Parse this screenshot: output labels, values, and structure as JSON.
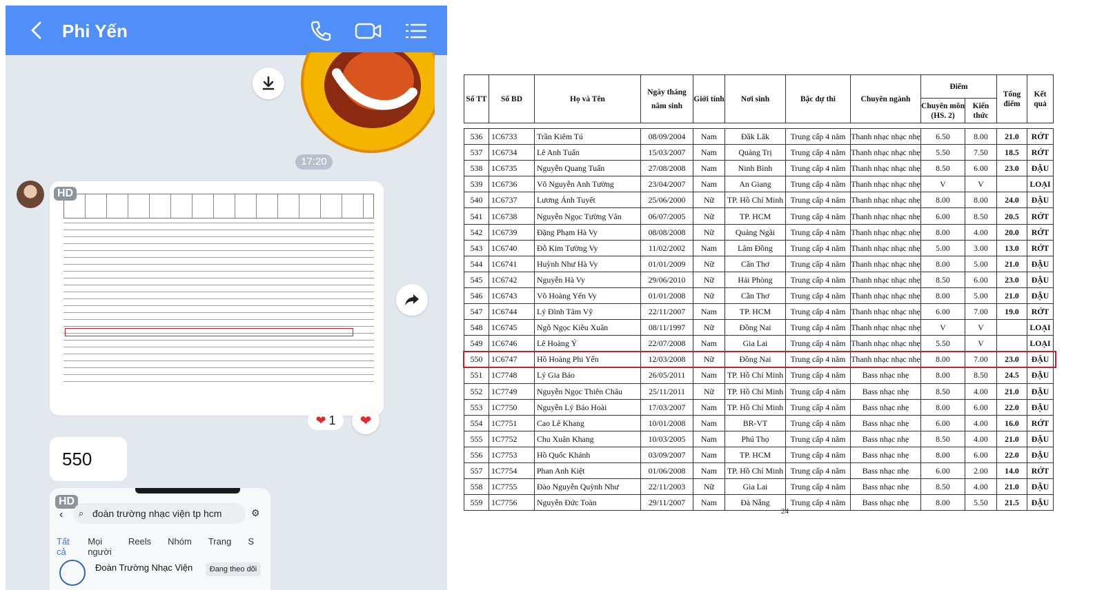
{
  "chat": {
    "contact_name": "Phi Yến",
    "time": "17:20",
    "hd_label": "HD",
    "reaction_count": "1",
    "text_message": "550",
    "icons": [
      "back-icon",
      "phone-icon",
      "video-icon",
      "menu-list-icon",
      "download-icon",
      "share-icon",
      "heart-icon"
    ],
    "shared_screenshot": {
      "search_text": "đoàn trường nhạc viện tp hcm",
      "tabs": [
        "Tất cả",
        "Mọi người",
        "Reels",
        "Nhóm",
        "Trang",
        "S"
      ],
      "result_name": "Đoàn Trường Nhạc Viện",
      "follow_label": "Đang theo dõi"
    }
  },
  "document": {
    "headers": {
      "stt": "Số TT",
      "sbd": "Số BD",
      "name": "Họ và Tên",
      "dob": "Ngày tháng năm sinh",
      "gender": "Giới tính",
      "place": "Nơi sinh",
      "level": "Bậc dự thi",
      "major": "Chuyên ngành",
      "diem": "Điểm",
      "chuyen_mon": "Chuyên môn (HS. 2)",
      "kien_thuc": "Kiến thức",
      "total": "Tổng điểm",
      "result": "Kết quả"
    },
    "page_number": "24",
    "rows": [
      {
        "stt": "536",
        "sbd": "1C6733",
        "name": "Trần Kiêm Tú",
        "dob": "08/09/2004",
        "gender": "Nam",
        "place": "Đăk Lăk",
        "level": "Trung cấp 4 năm",
        "major": "Thanh nhạc nhạc nhẹ",
        "cm": "6.50",
        "kt": "8.00",
        "total": "21.0",
        "result": "RỚT"
      },
      {
        "stt": "537",
        "sbd": "1C6734",
        "name": "Lê Anh Tuấn",
        "dob": "15/03/2007",
        "gender": "Nam",
        "place": "Quảng Trị",
        "level": "Trung cấp 4 năm",
        "major": "Thanh nhạc nhạc nhẹ",
        "cm": "5.50",
        "kt": "7.50",
        "total": "18.5",
        "result": "RỚT"
      },
      {
        "stt": "538",
        "sbd": "1C6735",
        "name": "Nguyễn Quang Tuấn",
        "dob": "27/08/2008",
        "gender": "Nam",
        "place": "Ninh Bình",
        "level": "Trung cấp 4 năm",
        "major": "Thanh nhạc nhạc nhẹ",
        "cm": "8.50",
        "kt": "6.00",
        "total": "23.0",
        "result": "ĐẬU"
      },
      {
        "stt": "539",
        "sbd": "1C6736",
        "name": "Võ Nguyễn Anh Tường",
        "dob": "23/04/2007",
        "gender": "Nam",
        "place": "An Giang",
        "level": "Trung cấp 4 năm",
        "major": "Thanh nhạc nhạc nhẹ",
        "cm": "V",
        "kt": "V",
        "total": "",
        "result": "LOẠI"
      },
      {
        "stt": "540",
        "sbd": "1C6737",
        "name": "Lương Ánh Tuyết",
        "dob": "25/06/2000",
        "gender": "Nữ",
        "place": "TP. Hồ Chí Minh",
        "level": "Trung cấp 4 năm",
        "major": "Thanh nhạc nhạc nhẹ",
        "cm": "8.00",
        "kt": "8.00",
        "total": "24.0",
        "result": "ĐẬU"
      },
      {
        "stt": "541",
        "sbd": "1C6738",
        "name": "Nguyễn Ngọc Tường Vân",
        "dob": "06/07/2005",
        "gender": "Nữ",
        "place": "TP. HCM",
        "level": "Trung cấp 4 năm",
        "major": "Thanh nhạc nhạc nhẹ",
        "cm": "6.00",
        "kt": "8.50",
        "total": "20.5",
        "result": "RỚT"
      },
      {
        "stt": "542",
        "sbd": "1C6739",
        "name": "Đặng Phạm Hà Vy",
        "dob": "08/08/2008",
        "gender": "Nữ",
        "place": "Quảng Ngãi",
        "level": "Trung cấp 4 năm",
        "major": "Thanh nhạc nhạc nhẹ",
        "cm": "8.00",
        "kt": "4.00",
        "total": "20.0",
        "result": "RỚT"
      },
      {
        "stt": "543",
        "sbd": "1C6740",
        "name": "Đỗ Kim Tường Vy",
        "dob": "11/02/2002",
        "gender": "Nam",
        "place": "Lâm Đồng",
        "level": "Trung cấp 4 năm",
        "major": "Thanh nhạc nhạc nhẹ",
        "cm": "5.00",
        "kt": "3.00",
        "total": "13.0",
        "result": "RỚT"
      },
      {
        "stt": "544",
        "sbd": "1C6741",
        "name": "Huỳnh Như Hà Vy",
        "dob": "01/01/2009",
        "gender": "Nữ",
        "place": "Cần Thơ",
        "level": "Trung cấp 4 năm",
        "major": "Thanh nhạc nhạc nhẹ",
        "cm": "8.00",
        "kt": "5.00",
        "total": "21.0",
        "result": "ĐẬU"
      },
      {
        "stt": "545",
        "sbd": "1C6742",
        "name": "Nguyễn Hà Vy",
        "dob": "29/06/2010",
        "gender": "Nữ",
        "place": "Hải Phòng",
        "level": "Trung cấp 4 năm",
        "major": "Thanh nhạc nhạc nhẹ",
        "cm": "8.50",
        "kt": "6.00",
        "total": "23.0",
        "result": "ĐẬU"
      },
      {
        "stt": "546",
        "sbd": "1C6743",
        "name": "Võ Hoàng Yến Vy",
        "dob": "01/01/2008",
        "gender": "Nữ",
        "place": "Cần Thơ",
        "level": "Trung cấp 4 năm",
        "major": "Thanh nhạc nhạc nhẹ",
        "cm": "8.00",
        "kt": "5.00",
        "total": "21.0",
        "result": "ĐẬU"
      },
      {
        "stt": "547",
        "sbd": "1C6744",
        "name": "Lý Đình Tâm Vỹ",
        "dob": "22/11/2007",
        "gender": "Nam",
        "place": "TP. HCM",
        "level": "Trung cấp 4 năm",
        "major": "Thanh nhạc nhạc nhẹ",
        "cm": "6.00",
        "kt": "7.00",
        "total": "19.0",
        "result": "RỚT"
      },
      {
        "stt": "548",
        "sbd": "1C6745",
        "name": "Ngô Ngọc Kiều Xuân",
        "dob": "08/11/1997",
        "gender": "Nữ",
        "place": "Đồng Nai",
        "level": "Trung cấp 4 năm",
        "major": "Thanh nhạc nhạc nhẹ",
        "cm": "V",
        "kt": "V",
        "total": "",
        "result": "LOẠI"
      },
      {
        "stt": "549",
        "sbd": "1C6746",
        "name": "Lê Hoàng Ý",
        "dob": "22/07/2008",
        "gender": "Nam",
        "place": "Gia Lai",
        "level": "Trung cấp 4 năm",
        "major": "Thanh nhạc nhạc nhẹ",
        "cm": "5.50",
        "kt": "V",
        "total": "",
        "result": "LOẠI"
      },
      {
        "stt": "550",
        "sbd": "1C6747",
        "name": "Hồ Hoàng Phi Yến",
        "dob": "12/03/2008",
        "gender": "Nữ",
        "place": "Đồng Nai",
        "level": "Trung cấp 4 năm",
        "major": "Thanh nhạc nhạc nhẹ",
        "cm": "8.00",
        "kt": "7.00",
        "total": "23.0",
        "result": "ĐẬU"
      },
      {
        "stt": "551",
        "sbd": "1C7748",
        "name": "Lý Gia Bảo",
        "dob": "26/05/2011",
        "gender": "Nam",
        "place": "TP. Hồ Chí Minh",
        "level": "Trung cấp 4 năm",
        "major": "Bass nhạc nhẹ",
        "cm": "8.00",
        "kt": "8.50",
        "total": "24.5",
        "result": "ĐẬU"
      },
      {
        "stt": "552",
        "sbd": "1C7749",
        "name": "Nguyễn Ngọc Thiên Châu",
        "dob": "25/11/2011",
        "gender": "Nữ",
        "place": "TP. Hồ Chí Minh",
        "level": "Trung cấp 4 năm",
        "major": "Bass nhạc nhẹ",
        "cm": "8.50",
        "kt": "4.00",
        "total": "21.0",
        "result": "ĐẬU"
      },
      {
        "stt": "553",
        "sbd": "1C7750",
        "name": "Nguyễn Lý Bảo Hoài",
        "dob": "17/03/2007",
        "gender": "Nam",
        "place": "TP. Hồ Chí Minh",
        "level": "Trung cấp 4 năm",
        "major": "Bass nhạc nhẹ",
        "cm": "8.00",
        "kt": "6.00",
        "total": "22.0",
        "result": "ĐẬU"
      },
      {
        "stt": "554",
        "sbd": "1C7751",
        "name": "Cao Lê Khang",
        "dob": "10/01/2008",
        "gender": "Nam",
        "place": "BR-VT",
        "level": "Trung cấp 4 năm",
        "major": "Bass nhạc nhẹ",
        "cm": "6.00",
        "kt": "4.00",
        "total": "16.0",
        "result": "RỚT"
      },
      {
        "stt": "555",
        "sbd": "1C7752",
        "name": "Chu Xuân Khang",
        "dob": "10/03/2005",
        "gender": "Nam",
        "place": "Phú Thọ",
        "level": "Trung cấp 4 năm",
        "major": "Bass nhạc nhẹ",
        "cm": "8.50",
        "kt": "4.00",
        "total": "21.0",
        "result": "ĐẬU"
      },
      {
        "stt": "556",
        "sbd": "1C7753",
        "name": "Hồ Quốc Khánh",
        "dob": "03/09/2007",
        "gender": "Nam",
        "place": "TP. HCM",
        "level": "Trung cấp 4 năm",
        "major": "Bass nhạc nhẹ",
        "cm": "8.00",
        "kt": "6.00",
        "total": "22.0",
        "result": "ĐẬU"
      },
      {
        "stt": "557",
        "sbd": "1C7754",
        "name": "Phan Anh Kiệt",
        "dob": "01/06/2008",
        "gender": "Nam",
        "place": "TP. Hồ Chí Minh",
        "level": "Trung cấp 4 năm",
        "major": "Bass nhạc nhẹ",
        "cm": "6.00",
        "kt": "2.00",
        "total": "14.0",
        "result": "RỚT"
      },
      {
        "stt": "558",
        "sbd": "1C7755",
        "name": "Đào Nguyễn Quỳnh Như",
        "dob": "22/11/2003",
        "gender": "Nữ",
        "place": "Gia Lai",
        "level": "Trung cấp 4 năm",
        "major": "Bass nhạc nhẹ",
        "cm": "8.50",
        "kt": "4.00",
        "total": "21.0",
        "result": "ĐẬU"
      },
      {
        "stt": "559",
        "sbd": "1C7756",
        "name": "Nguyễn Đức Toàn",
        "dob": "29/11/2007",
        "gender": "Nam",
        "place": "Đà Nẵng",
        "level": "Trung cấp 4 năm",
        "major": "Bass nhạc nhẹ",
        "cm": "8.00",
        "kt": "5.50",
        "total": "21.5",
        "result": "ĐẬU"
      }
    ],
    "highlighted_stt": "550"
  }
}
